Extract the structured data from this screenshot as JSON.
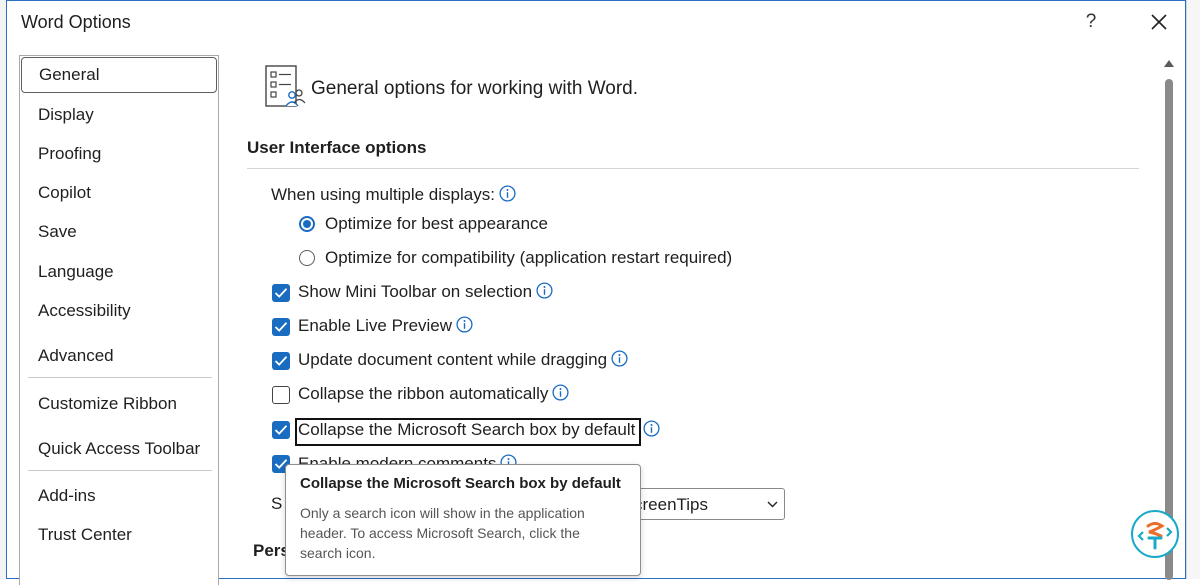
{
  "window": {
    "title": "Word Options",
    "help_label": "?"
  },
  "nav": {
    "items": [
      {
        "label": "General"
      },
      {
        "label": "Display"
      },
      {
        "label": "Proofing"
      },
      {
        "label": "Copilot"
      },
      {
        "label": "Save"
      },
      {
        "label": "Language"
      },
      {
        "label": "Accessibility"
      },
      {
        "label": "Advanced"
      },
      {
        "label": "Customize Ribbon"
      },
      {
        "label": "Quick Access Toolbar"
      },
      {
        "label": "Add-ins"
      },
      {
        "label": "Trust Center"
      }
    ],
    "selected": "General"
  },
  "main": {
    "heading": "General options for working with Word.",
    "section_title": "User Interface options",
    "displays_label": "When using multiple displays:",
    "radios": [
      {
        "label": "Optimize for best appearance",
        "checked": true
      },
      {
        "label": "Optimize for compatibility (application restart required)",
        "checked": false
      }
    ],
    "checkboxes": [
      {
        "label": "Show Mini Toolbar on selection",
        "checked": true
      },
      {
        "label": "Enable Live Preview",
        "checked": true
      },
      {
        "label": "Update document content while dragging",
        "checked": true
      },
      {
        "label": "Collapse the ribbon automatically",
        "checked": false
      },
      {
        "label": "Collapse the Microsoft Search box by default",
        "checked": true,
        "focused": true
      },
      {
        "label": "Enable modern comments",
        "checked": true,
        "partially_hidden": true
      }
    ],
    "screentip_row_prefix": "S",
    "screentip_select_value": "creenTips",
    "personalize_section_prefix": "Pers"
  },
  "tooltip": {
    "title": "Collapse the Microsoft Search box by default",
    "body": "Only a search icon will show in the application header. To access Microsoft Search, click the search icon."
  },
  "colors": {
    "accent": "#1a6cc1",
    "window_border": "#2b6fc4",
    "logo": "#19a9c9"
  },
  "icons": {
    "close": "close-icon",
    "info": "info-icon",
    "page": "general-options-icon",
    "chevron": "chevron-down-icon"
  }
}
